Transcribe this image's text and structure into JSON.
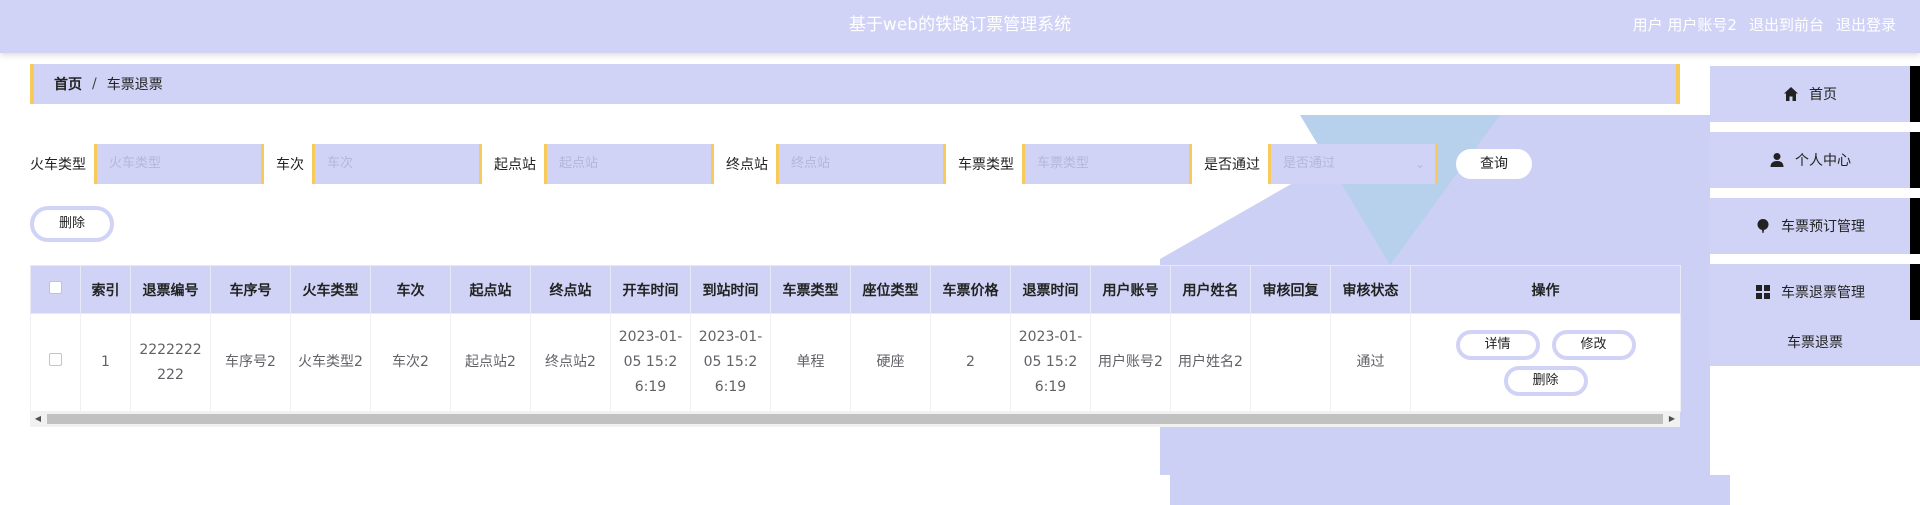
{
  "header": {
    "title": "基于web的铁路订票管理系统",
    "user_prefix": "用户",
    "user_account": "用户账号2",
    "back_front": "退出到前台",
    "logout": "退出登录"
  },
  "breadcrumb": {
    "home": "首页",
    "separator": "/",
    "current": "车票退票"
  },
  "search": {
    "fields": [
      {
        "label": "火车类型",
        "placeholder": "火车类型"
      },
      {
        "label": "车次",
        "placeholder": "车次"
      },
      {
        "label": "起点站",
        "placeholder": "起点站"
      },
      {
        "label": "终点站",
        "placeholder": "终点站"
      },
      {
        "label": "车票类型",
        "placeholder": "车票类型"
      },
      {
        "label": "是否通过",
        "placeholder": "是否通过"
      }
    ],
    "button": "查询"
  },
  "toolbar": {
    "delete_label": "删除"
  },
  "table": {
    "headers": [
      "索引",
      "退票编号",
      "车序号",
      "火车类型",
      "车次",
      "起点站",
      "终点站",
      "开车时间",
      "到站时间",
      "车票类型",
      "座位类型",
      "车票价格",
      "退票时间",
      "用户账号",
      "用户姓名",
      "审核回复",
      "审核状态",
      "操作"
    ],
    "rows": [
      {
        "index": "1",
        "refund_no": "2222222222",
        "car_seq": "车序号2",
        "train_type": "火车类型2",
        "train_no": "车次2",
        "from": "起点站2",
        "to": "终点站2",
        "depart": "2023-01-05 15:26:19",
        "arrive": "2023-01-05 15:26:19",
        "ticket_type": "单程",
        "seat_type": "硬座",
        "price": "2",
        "refund_time": "2023-01-05 15:26:19",
        "user_account": "用户账号2",
        "user_name": "用户姓名2",
        "review_reply": "",
        "review_status": "通过",
        "actions": {
          "detail": "详情",
          "edit": "修改",
          "delete": "删除"
        }
      }
    ]
  },
  "sidebar": {
    "items": [
      {
        "label": "首页",
        "icon": "home-icon"
      },
      {
        "label": "个人中心",
        "icon": "user-icon"
      },
      {
        "label": "车票预订管理",
        "icon": "balloon-icon"
      },
      {
        "label": "车票退票管理",
        "icon": "grid-icon"
      }
    ],
    "sub_item": "车票退票"
  }
}
